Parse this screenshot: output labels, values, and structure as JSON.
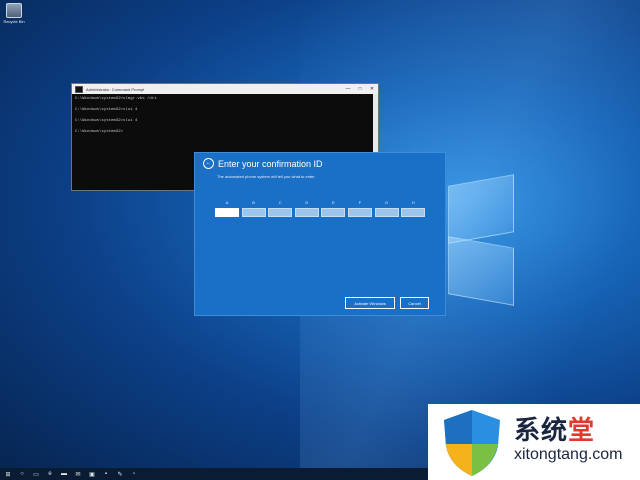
{
  "desktop": {
    "icon_label": "Recycle Bin",
    "icon_name": "recycle-bin-icon"
  },
  "cmd": {
    "title": "Administrator: Command Prompt",
    "lines": [
      "C:\\Windows\\system32>slmgr.vbs /dti",
      "C:\\Windows\\system32>slui 4",
      "C:\\Windows\\system32>slui 4",
      "C:\\Windows\\system32>"
    ],
    "controls": [
      "—",
      "□",
      "✕"
    ]
  },
  "dialog": {
    "title": "Enter your confirmation ID",
    "subtitle": "The automated phone system will tell you what to enter.",
    "fields": [
      {
        "letter": "A",
        "value": ""
      },
      {
        "letter": "B",
        "value": ""
      },
      {
        "letter": "C",
        "value": ""
      },
      {
        "letter": "D",
        "value": ""
      },
      {
        "letter": "E",
        "value": ""
      },
      {
        "letter": "F",
        "value": ""
      },
      {
        "letter": "G",
        "value": ""
      },
      {
        "letter": "H",
        "value": ""
      }
    ],
    "activate_label": "Activate Windows",
    "cancel_label": "Cancel"
  },
  "taskbar": {
    "items": [
      "start-icon",
      "search-icon",
      "task-view-icon",
      "edge-icon",
      "file-explorer-icon",
      "mail-icon",
      "store-icon",
      "terminal-icon",
      "paint-icon",
      "app-icon"
    ]
  },
  "watermark": {
    "brand_cn_main": "系统",
    "brand_cn_accent": "堂",
    "url": "xitongtang.com"
  },
  "colors": {
    "dialog_bg": "#1a6fc6",
    "taskbar_bg": "#0a1c33",
    "watermark_accent": "#e03a2e"
  }
}
